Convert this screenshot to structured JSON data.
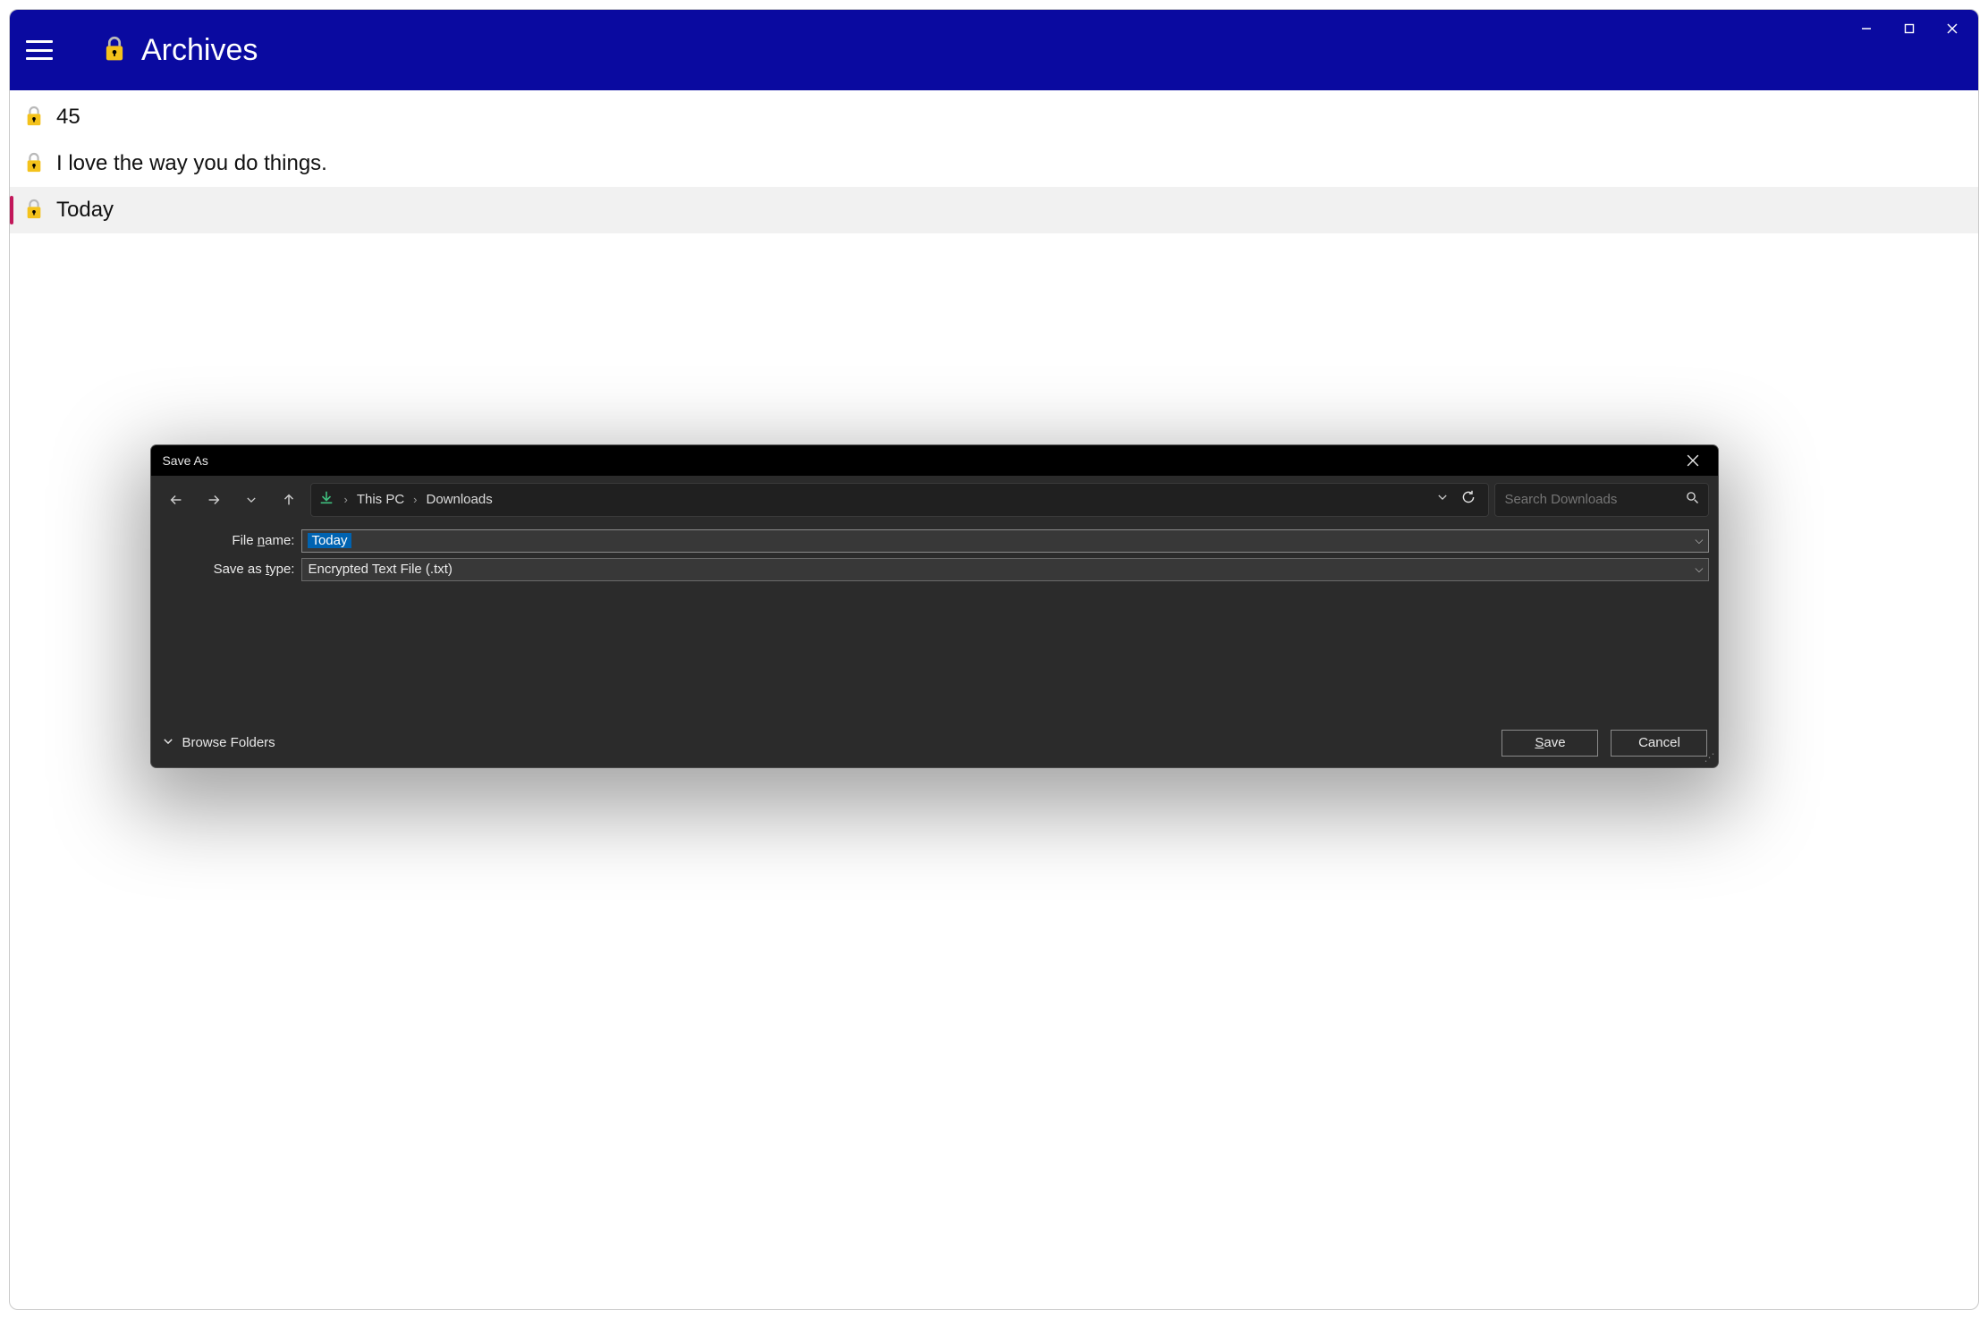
{
  "header": {
    "title": "Archives"
  },
  "list": {
    "items": [
      {
        "label": "45",
        "selected": false
      },
      {
        "label": "I love the way you do things.",
        "selected": false
      },
      {
        "label": "Today",
        "selected": true
      }
    ]
  },
  "saveas": {
    "title": "Save As",
    "breadcrumbs": [
      "This PC",
      "Downloads"
    ],
    "search_placeholder": "Search Downloads",
    "filename_label": "File name:",
    "filename_label_underline": "n",
    "filename_value": "Today",
    "saveastype_label": "Save as type:",
    "saveastype_label_underline": "t",
    "saveastype_value": "Encrypted Text File (.txt)",
    "browse_folders_label": "Browse Folders",
    "save_button": "Save",
    "cancel_button": "Cancel"
  }
}
